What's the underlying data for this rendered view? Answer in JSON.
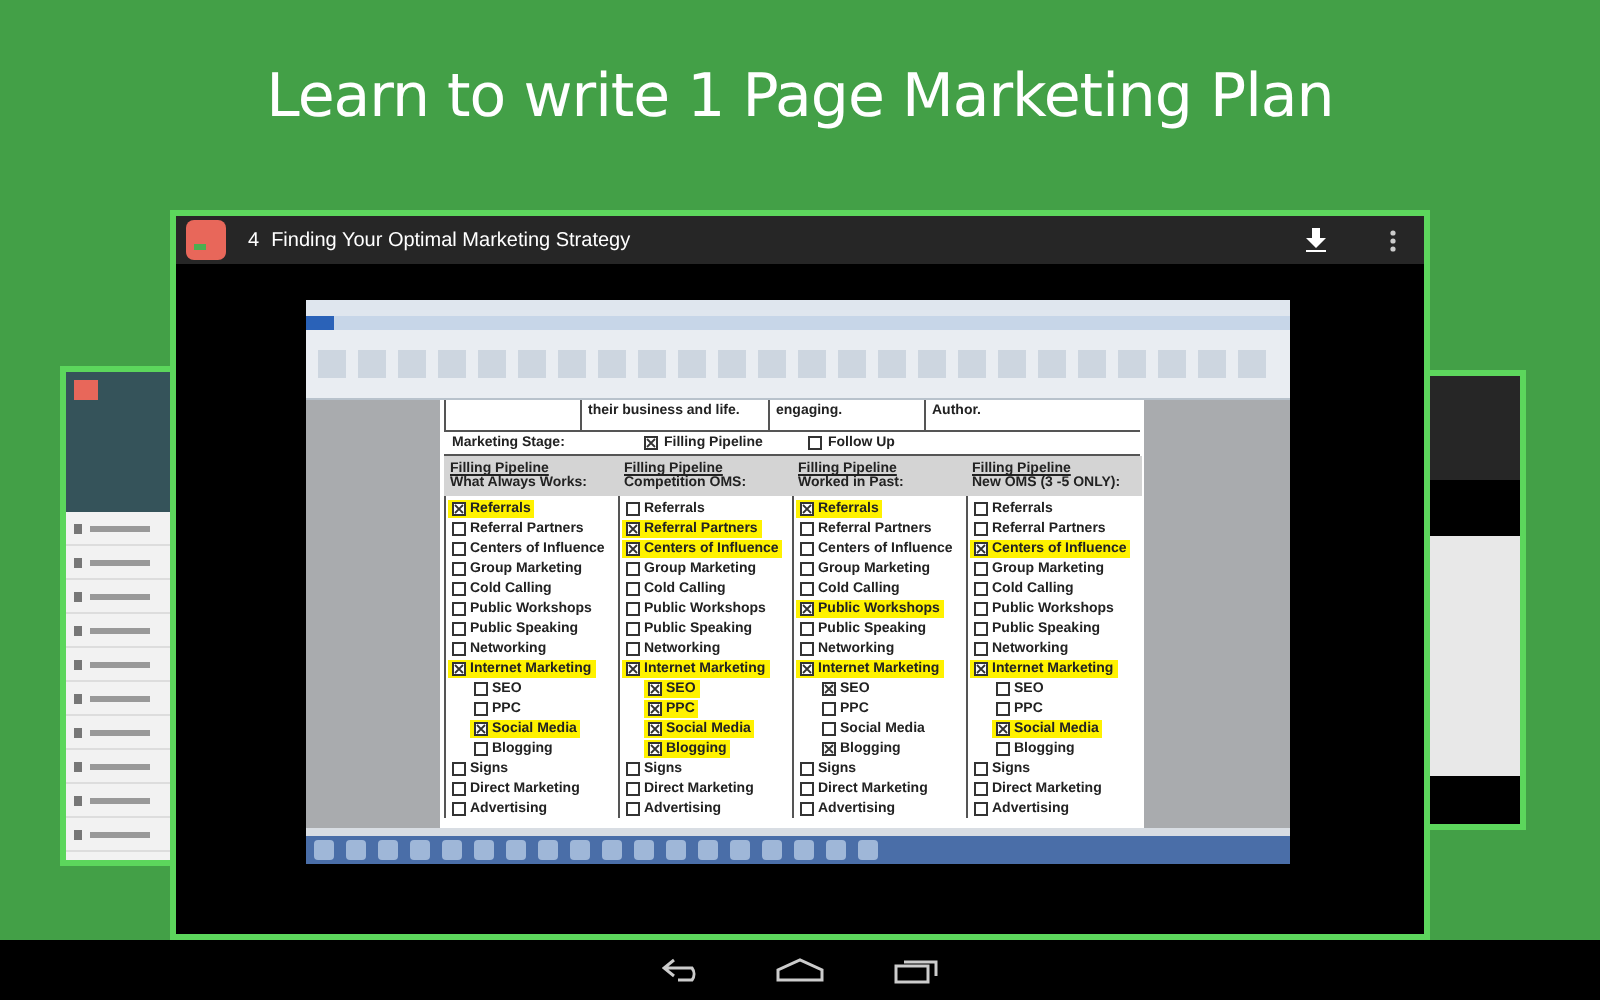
{
  "headline": "Learn to write 1 Page Marketing Plan",
  "player": {
    "lesson_number": "4",
    "lesson_title": "Finding Your Optimal Marketing Strategy"
  },
  "document": {
    "intro_cells": [
      "their business and life.",
      "engaging.",
      "Author."
    ],
    "marketing_stage": {
      "label": "Marketing Stage:",
      "options": [
        {
          "label": "Filling Pipeline",
          "checked": true
        },
        {
          "label": "Follow Up",
          "checked": false
        }
      ]
    },
    "columns": [
      {
        "heading": "Filling Pipeline",
        "subheading": "What Always Works:",
        "items": [
          {
            "label": "Referrals",
            "checked": true,
            "highlighted": true
          },
          {
            "label": "Referral Partners",
            "checked": false,
            "highlighted": false
          },
          {
            "label": "Centers of Influence",
            "checked": false,
            "highlighted": false
          },
          {
            "label": "Group Marketing",
            "checked": false,
            "highlighted": false
          },
          {
            "label": "Cold Calling",
            "checked": false,
            "highlighted": false
          },
          {
            "label": "Public Workshops",
            "checked": false,
            "highlighted": false
          },
          {
            "label": "Public Speaking",
            "checked": false,
            "highlighted": false
          },
          {
            "label": "Networking",
            "checked": false,
            "highlighted": false
          },
          {
            "label": "Internet Marketing",
            "checked": true,
            "highlighted": true,
            "children": [
              {
                "label": "SEO",
                "checked": false,
                "highlighted": false
              },
              {
                "label": "PPC",
                "checked": false,
                "highlighted": false
              },
              {
                "label": "Social Media",
                "checked": true,
                "highlighted": true
              },
              {
                "label": "Blogging",
                "checked": false,
                "highlighted": false
              }
            ]
          },
          {
            "label": "Signs",
            "checked": false,
            "highlighted": false
          },
          {
            "label": "Direct Marketing",
            "checked": false,
            "highlighted": false
          },
          {
            "label": "Advertising",
            "checked": false,
            "highlighted": false
          }
        ]
      },
      {
        "heading": "Filling Pipeline",
        "subheading": "Competition OMS:",
        "items": [
          {
            "label": "Referrals",
            "checked": false,
            "highlighted": false
          },
          {
            "label": "Referral Partners",
            "checked": true,
            "highlighted": true
          },
          {
            "label": "Centers of Influence",
            "checked": true,
            "highlighted": true
          },
          {
            "label": "Group Marketing",
            "checked": false,
            "highlighted": false
          },
          {
            "label": "Cold Calling",
            "checked": false,
            "highlighted": false
          },
          {
            "label": "Public Workshops",
            "checked": false,
            "highlighted": false
          },
          {
            "label": "Public Speaking",
            "checked": false,
            "highlighted": false
          },
          {
            "label": "Networking",
            "checked": false,
            "highlighted": false
          },
          {
            "label": "Internet Marketing",
            "checked": true,
            "highlighted": true,
            "children": [
              {
                "label": "SEO",
                "checked": true,
                "highlighted": true
              },
              {
                "label": "PPC",
                "checked": true,
                "highlighted": true
              },
              {
                "label": "Social Media",
                "checked": true,
                "highlighted": true
              },
              {
                "label": "Blogging",
                "checked": true,
                "highlighted": true
              }
            ]
          },
          {
            "label": "Signs",
            "checked": false,
            "highlighted": false
          },
          {
            "label": "Direct Marketing",
            "checked": false,
            "highlighted": false
          },
          {
            "label": "Advertising",
            "checked": false,
            "highlighted": false
          }
        ]
      },
      {
        "heading": "Filling Pipeline",
        "subheading": "Worked in Past:",
        "items": [
          {
            "label": "Referrals",
            "checked": true,
            "highlighted": true
          },
          {
            "label": "Referral Partners",
            "checked": false,
            "highlighted": false
          },
          {
            "label": "Centers of Influence",
            "checked": false,
            "highlighted": false
          },
          {
            "label": "Group Marketing",
            "checked": false,
            "highlighted": false
          },
          {
            "label": "Cold Calling",
            "checked": false,
            "highlighted": false
          },
          {
            "label": "Public Workshops",
            "checked": true,
            "highlighted": true
          },
          {
            "label": "Public Speaking",
            "checked": false,
            "highlighted": false
          },
          {
            "label": "Networking",
            "checked": false,
            "highlighted": false
          },
          {
            "label": "Internet Marketing",
            "checked": true,
            "highlighted": true,
            "children": [
              {
                "label": "SEO",
                "checked": true,
                "highlighted": false
              },
              {
                "label": "PPC",
                "checked": false,
                "highlighted": false
              },
              {
                "label": "Social Media",
                "checked": false,
                "highlighted": false
              },
              {
                "label": "Blogging",
                "checked": true,
                "highlighted": false
              }
            ]
          },
          {
            "label": "Signs",
            "checked": false,
            "highlighted": false
          },
          {
            "label": "Direct Marketing",
            "checked": false,
            "highlighted": false
          },
          {
            "label": "Advertising",
            "checked": false,
            "highlighted": false
          }
        ]
      },
      {
        "heading": "Filling Pipeline",
        "subheading": "New OMS (3 -5 ONLY):",
        "items": [
          {
            "label": "Referrals",
            "checked": false,
            "highlighted": false
          },
          {
            "label": "Referral Partners",
            "checked": false,
            "highlighted": false
          },
          {
            "label": "Centers of Influence",
            "checked": true,
            "highlighted": true
          },
          {
            "label": "Group Marketing",
            "checked": false,
            "highlighted": false
          },
          {
            "label": "Cold Calling",
            "checked": false,
            "highlighted": false
          },
          {
            "label": "Public Workshops",
            "checked": false,
            "highlighted": false
          },
          {
            "label": "Public Speaking",
            "checked": false,
            "highlighted": false
          },
          {
            "label": "Networking",
            "checked": false,
            "highlighted": false
          },
          {
            "label": "Internet Marketing",
            "checked": true,
            "highlighted": true,
            "children": [
              {
                "label": "SEO",
                "checked": false,
                "highlighted": false
              },
              {
                "label": "PPC",
                "checked": false,
                "highlighted": false
              },
              {
                "label": "Social Media",
                "checked": true,
                "highlighted": true
              },
              {
                "label": "Blogging",
                "checked": false,
                "highlighted": false
              }
            ]
          },
          {
            "label": "Signs",
            "checked": false,
            "highlighted": false
          },
          {
            "label": "Direct Marketing",
            "checked": false,
            "highlighted": false
          },
          {
            "label": "Advertising",
            "checked": false,
            "highlighted": false
          }
        ]
      }
    ]
  }
}
